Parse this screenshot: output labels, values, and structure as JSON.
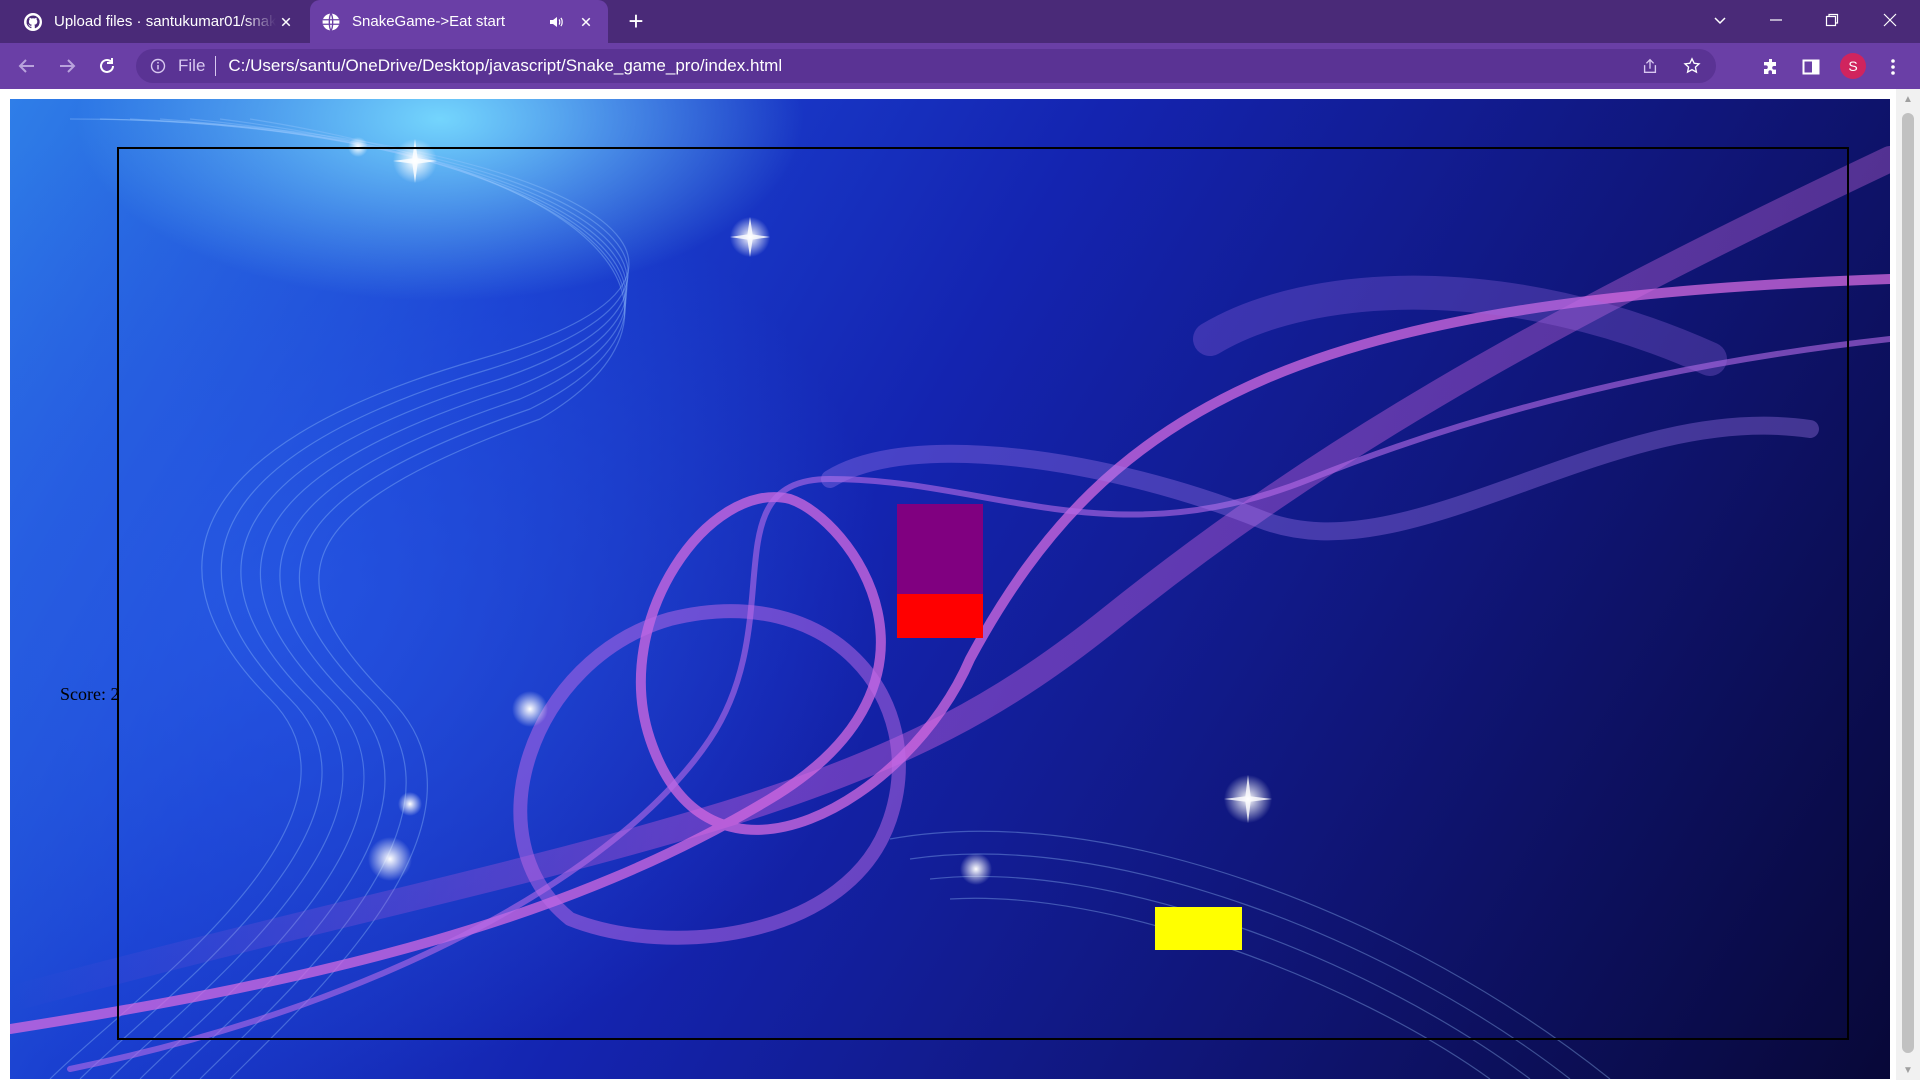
{
  "browser": {
    "tabs": [
      {
        "title": "Upload files · santukumar01/snak",
        "icon": "github-icon",
        "active": false
      },
      {
        "title": "SnakeGame->Eat start",
        "icon": "globe-icon",
        "active": true,
        "audio": true
      }
    ],
    "new_tab_label": "+",
    "address_bar": {
      "scheme_label": "File",
      "url": "C:/Users/santu/OneDrive/Desktop/javascript/Snake_game_pro/index.html"
    },
    "profile_initial": "S",
    "colors": {
      "tabstrip": "#4a2a78",
      "toolbar": "#6a3fa6",
      "avatar": "#d0245e"
    }
  },
  "game": {
    "score_text": "Score: 2",
    "board_border_color": "#000000",
    "snake": [
      {
        "part": "body",
        "color": "#800080"
      },
      {
        "part": "body",
        "color": "#800080"
      },
      {
        "part": "head",
        "color": "#ff0000"
      }
    ],
    "food": {
      "color": "#ffff00"
    }
  }
}
